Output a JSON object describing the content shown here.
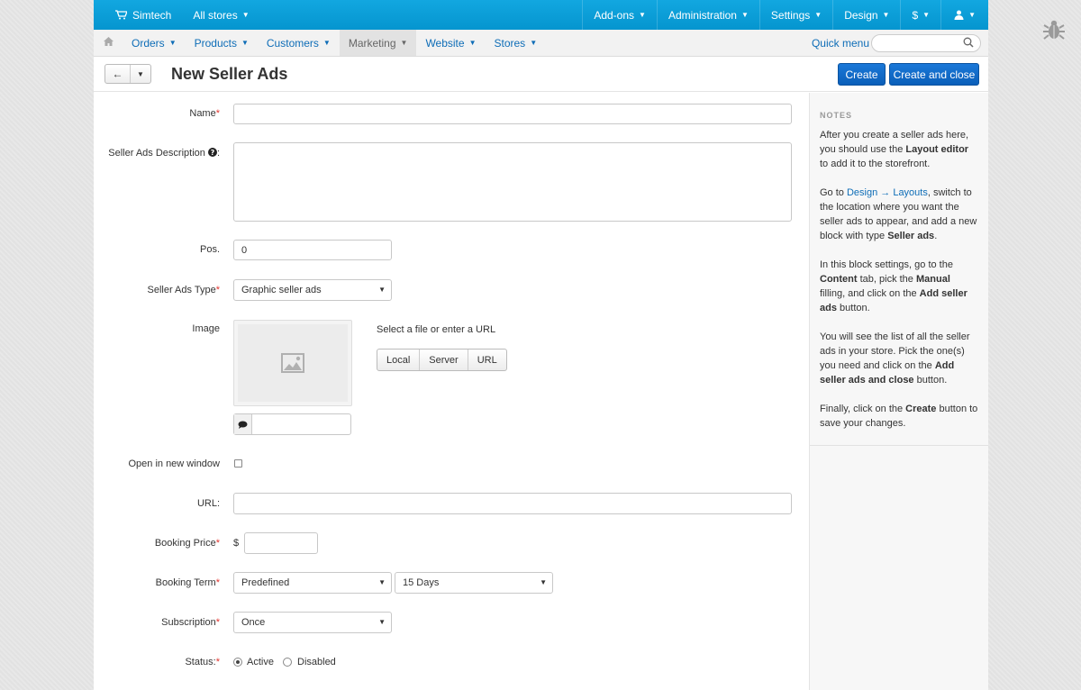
{
  "topbar": {
    "store_name": "Simtech",
    "all_stores": "All stores",
    "menus": [
      "Add-ons",
      "Administration",
      "Settings",
      "Design",
      "$"
    ]
  },
  "nav": {
    "items": [
      "Orders",
      "Products",
      "Customers",
      "Marketing",
      "Website",
      "Stores"
    ],
    "quick_menu": "Quick menu"
  },
  "title": "New Seller Ads",
  "buttons": {
    "create": "Create",
    "create_close": "Create and close"
  },
  "form": {
    "name_label": "Name",
    "description_label": "Seller Ads Description",
    "pos_label": "Pos.",
    "pos_value": "0",
    "type_label": "Seller Ads Type",
    "type_value": "Graphic seller ads",
    "image_label": "Image",
    "image_prompt": "Select a file or enter a URL",
    "image_sources": [
      "Local",
      "Server",
      "URL"
    ],
    "new_window_label": "Open in new window",
    "url_label": "URL:",
    "price_label": "Booking Price",
    "currency": "$",
    "term_label": "Booking Term",
    "term_value": "Predefined",
    "term_days": "15 Days",
    "subscription_label": "Subscription",
    "subscription_value": "Once",
    "status_label": "Status:",
    "status_active": "Active",
    "status_disabled": "Disabled"
  },
  "notes": {
    "header": "NOTES",
    "p1": [
      "After you create a seller ads here, you should use the ",
      "Layout editor",
      " to add it to the storefront."
    ],
    "p2": [
      "Go to ",
      "Design → Layouts",
      ", switch to the location where you want the seller ads to appear, and add a new block with type ",
      "Seller ads",
      "."
    ],
    "p3": [
      "In this block settings, go to the ",
      "Content",
      " tab, pick the ",
      "Manual",
      " filling, and click on the ",
      "Add seller ads",
      " button."
    ],
    "p4": [
      "You will see the list of all the seller ads in your store. Pick the one(s) you need and click on the ",
      "Add seller ads and close",
      " button."
    ],
    "p5": [
      "Finally, click on the ",
      "Create",
      " button to save your changes."
    ]
  },
  "colors": {
    "topbar": "#0a9ed8",
    "link": "#0e6db7",
    "primary": "#0b5fb9",
    "required": "#e3342f"
  }
}
